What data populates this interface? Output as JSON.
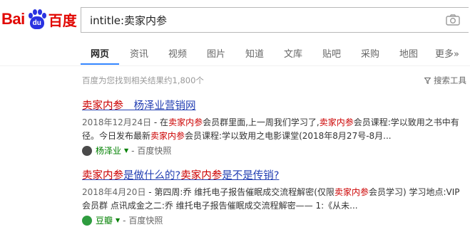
{
  "logo": {
    "part1": "Bai",
    "paw_text": "du",
    "part2": "百度"
  },
  "search": {
    "query": "intitle:卖家内参"
  },
  "nav": {
    "items": [
      {
        "label": "网页",
        "active": true
      },
      {
        "label": "资讯"
      },
      {
        "label": "视频"
      },
      {
        "label": "图片"
      },
      {
        "label": "知道"
      },
      {
        "label": "文库"
      },
      {
        "label": "贴吧"
      },
      {
        "label": "采购"
      },
      {
        "label": "地图"
      },
      {
        "label": "更多»"
      }
    ]
  },
  "stats": {
    "result_count": "百度为您找到相关结果约1,800个",
    "search_tools": "搜索工具"
  },
  "results": [
    {
      "title_parts": [
        {
          "t": "卖家内参",
          "em": true
        },
        {
          "t": "＿杨泽业营销网"
        }
      ],
      "date": "2018年12月24日",
      "abstract_parts": [
        {
          "t": " - 在"
        },
        {
          "t": "卖家内参",
          "em": true
        },
        {
          "t": "会员群里面,上一周我们学习了,"
        },
        {
          "t": "卖家内参",
          "em": true
        },
        {
          "t": "会员课程:学以致用之书中有径。今日发布最新"
        },
        {
          "t": "卖家内参",
          "em": true
        },
        {
          "t": "会员课程:学以致用之电影课堂(2018年8月27号-8月..."
        }
      ],
      "source": "杨泽业",
      "snapshot": "百度快照",
      "avatar_color": "#4a4a4a"
    },
    {
      "title_parts": [
        {
          "t": "卖家内参",
          "em": true
        },
        {
          "t": "是做什么的?"
        },
        {
          "t": "卖家内参",
          "em": true
        },
        {
          "t": "是不是传销?"
        }
      ],
      "date": "2018年4月20日",
      "abstract_parts": [
        {
          "t": " - 第四周:乔 维托电子报告催眠成交流程解密(仅限"
        },
        {
          "t": "卖家内参",
          "em": true
        },
        {
          "t": "会员学习) 学习地点:VIP会员群 点讯成金之二:乔 维托电子报告催眠成交流程解密—— 1:《从未..."
        }
      ],
      "source": "豆瓣",
      "snapshot": "百度快照",
      "avatar_color": "#2e9c3f"
    }
  ],
  "colors": {
    "brand_red": "#e10601",
    "brand_blue": "#2932e1",
    "link": "#2440b3",
    "highlight": "#cc0000",
    "source_green": "#008000"
  }
}
